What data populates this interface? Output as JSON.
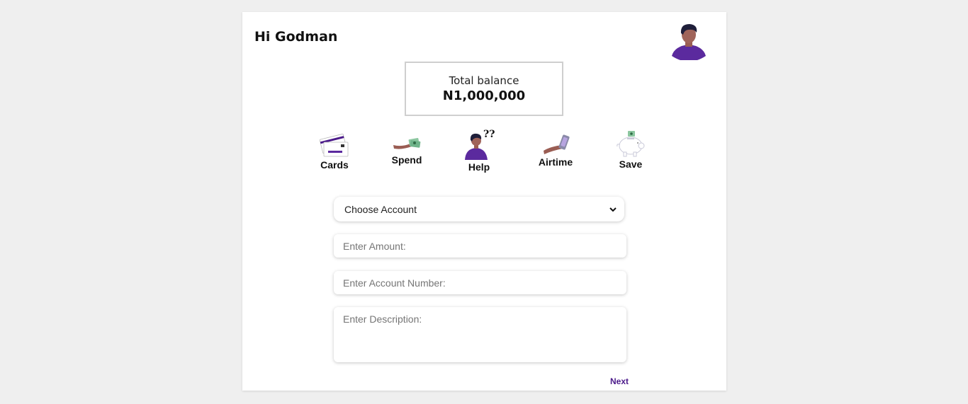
{
  "header": {
    "greeting": "Hi Godman"
  },
  "balance": {
    "label": "Total balance",
    "value": "N1,000,000"
  },
  "actions": [
    {
      "label": "Cards",
      "icon": "cards-icon"
    },
    {
      "label": "Spend",
      "icon": "spend-icon"
    },
    {
      "label": "Help",
      "icon": "help-icon"
    },
    {
      "label": "Airtime",
      "icon": "airtime-icon"
    },
    {
      "label": "Save",
      "icon": "piggy-bank-icon"
    }
  ],
  "form": {
    "account_select": "Choose Account",
    "amount_placeholder": "Enter Amount:",
    "account_number_placeholder": "Enter Account Number:",
    "description_placeholder": "Enter Description:",
    "next_label": "Next"
  },
  "colors": {
    "accent": "#5b2a9e",
    "skin": "#a0645a",
    "background": "#efefef",
    "card": "#ffffff"
  }
}
